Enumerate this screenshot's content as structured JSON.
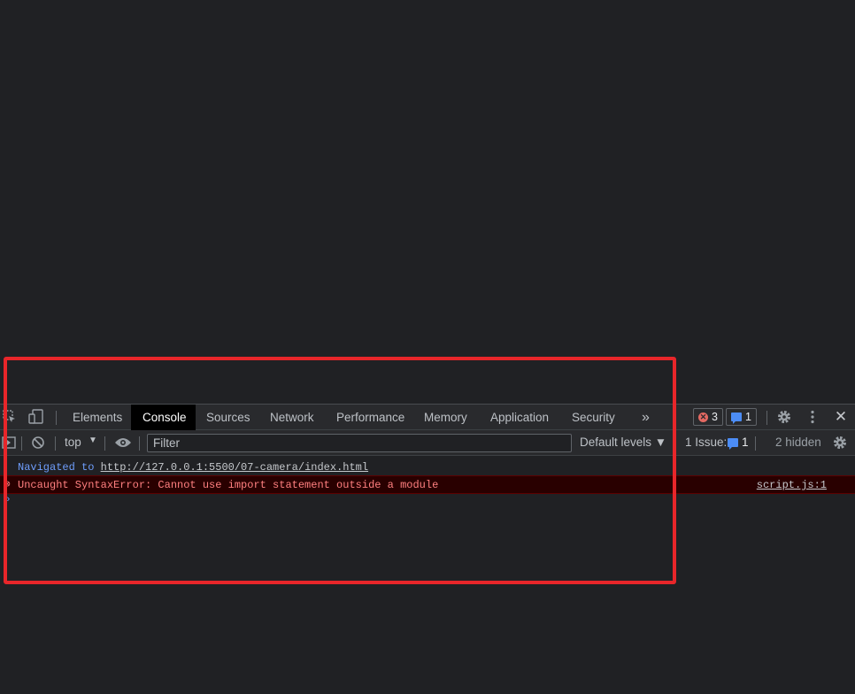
{
  "devtools": {
    "tabs": [
      {
        "label": "Elements"
      },
      {
        "label": "Console"
      },
      {
        "label": "Sources"
      },
      {
        "label": "Network"
      },
      {
        "label": "Performance"
      },
      {
        "label": "Memory"
      },
      {
        "label": "Application"
      },
      {
        "label": "Security"
      }
    ],
    "more_tabs_label": "»",
    "error_count": "3",
    "message_count": "1",
    "close_label": "✕"
  },
  "console_toolbar": {
    "context": "top",
    "filter_placeholder": "Filter",
    "levels": "Default levels ▼",
    "issues_label": "1 Issue:",
    "issues_count": "1",
    "hidden_label": "2 hidden"
  },
  "console": {
    "nav_prefix": "Navigated to",
    "nav_url": "http://127.0.0.1:5500/07-camera/index.html",
    "error_message": "Uncaught SyntaxError: Cannot use import statement outside a module",
    "error_source": "script.js:1"
  },
  "colors": {
    "panel_bg": "#292a2d",
    "page_bg": "#202124",
    "error_text": "#ff8080",
    "highlight_border": "#e8262a"
  }
}
